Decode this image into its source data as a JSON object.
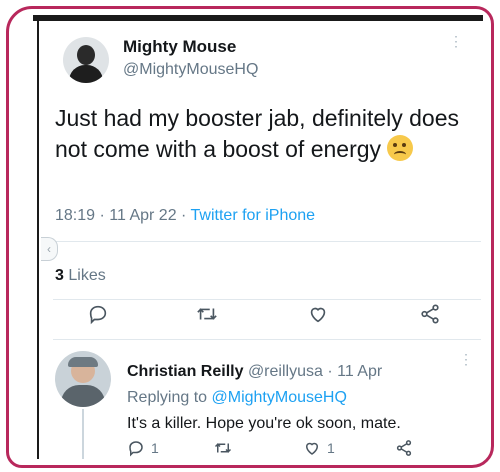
{
  "tweet": {
    "author_name": "Mighty Mouse",
    "author_handle": "@MightyMouseHQ",
    "more_icon": "more-dots-icon",
    "text": "Just had my booster jab, definitely does not come with a boost of energy",
    "emoji": "woozy-face-emoji",
    "time": "18:19",
    "date": "11 Apr 22",
    "source": "Twitter for iPhone",
    "likes_count": "3",
    "likes_label": "Likes"
  },
  "actions": {
    "icons": [
      "reply-icon",
      "retweet-icon",
      "like-icon",
      "share-icon"
    ]
  },
  "reply": {
    "author_name": "Christian Reilly",
    "author_handle": "@reillyusa",
    "date": "11 Apr",
    "replying_prefix": "Replying to",
    "replying_mention": "@MightyMouseHQ",
    "text": "It's a killer. Hope you're ok soon, mate.",
    "reply_count": "1",
    "like_count": "1"
  },
  "colors": {
    "frame_border": "#b8285c",
    "link_blue": "#1da1f2",
    "muted_gray": "#657786",
    "text_dark": "#14171a"
  }
}
